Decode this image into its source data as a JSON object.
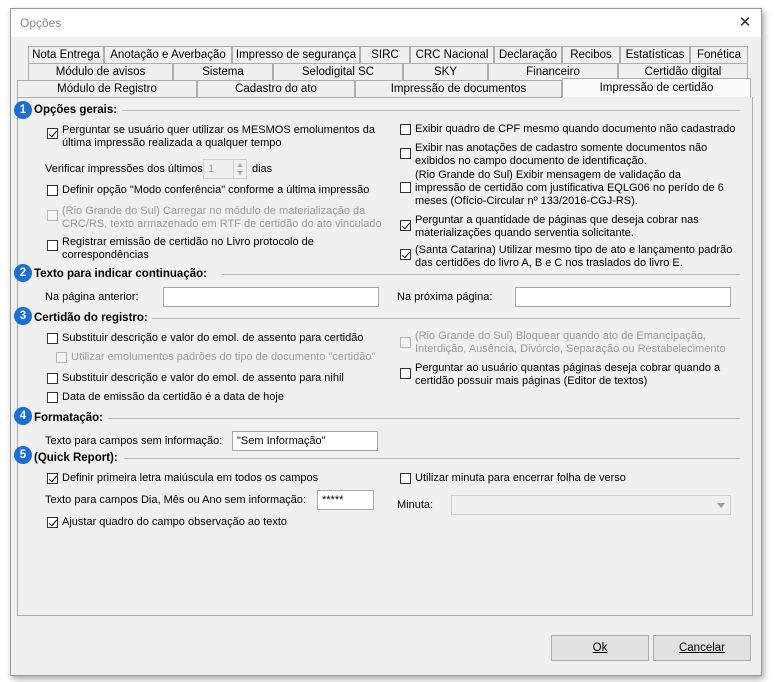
{
  "window": {
    "title": "Opções",
    "close_glyph": "✕"
  },
  "tabs": {
    "row1": [
      "Nota Entrega",
      "Anotação e Averbação",
      "Impresso de segurança",
      "SIRC",
      "CRC Nacional",
      "Declaração",
      "Recibos",
      "Estatísticas",
      "Fonética"
    ],
    "row2": [
      "Módulo de avisos",
      "Sistema",
      "Selodigital SC",
      "SKY",
      "Financeiro",
      "Certidão digital"
    ],
    "row3": [
      "Módulo de Registro",
      "Cadastro do ato",
      "Impressão de documentos",
      "Impressão de certidão"
    ],
    "active": "Impressão de certidão"
  },
  "sections": {
    "s1": {
      "badge": "1",
      "title": "Opções gerais:"
    },
    "s2": {
      "badge": "2",
      "title": "Texto para indicar continuação:"
    },
    "s3": {
      "badge": "3",
      "title": "Certidão do registro:"
    },
    "s4": {
      "badge": "4",
      "title": "Formatação:"
    },
    "s5": {
      "badge": "5",
      "title": "(Quick Report):"
    }
  },
  "general": {
    "ask_same_fees": {
      "label": "Perguntar se usuário quer utilizar os MESMOS emolumentos da última impressão realizada a qualquer tempo",
      "checked": true
    },
    "verify_label": "Verificar impressões dos últimos",
    "verify_value": "1",
    "verify_unit": "dias",
    "conference_mode": {
      "label": "Definir opção \"Modo conferência\" conforme a última impressão",
      "checked": false
    },
    "rgs_load_rtf": {
      "label": "(Rio Grande do Sul) Carregar no módulo de materialização da CRC/RS, texto armazenado em RTF de certidão do ato vinculado",
      "checked": false
    },
    "register_book": {
      "label": "Registrar emissão de certidão no Livro protocolo de correspondências",
      "checked": false
    },
    "show_cpf": {
      "label": "Exibir quadro de CPF mesmo quando documento não cadastrado",
      "checked": false
    },
    "show_annotations": {
      "label": "Exibir nas anotações de cadastro somente documentos não exibidos no campo documento de identificação.",
      "checked": false
    },
    "rgs_validation": {
      "label": "(Rio Grande do Sul) Exibir mensagem de validação da impressão de certidão com justificativa EQLG06 no perído de 6 meses (Ofício-Circular nº 133/2016-CGJ-RS).",
      "checked": false
    },
    "ask_pages": {
      "label": "Perguntar a quantidade de páginas que deseja cobrar nas materializações quando serventia solicitante.",
      "checked": true
    },
    "sc_same_type": {
      "label": "(Santa Catarina) Utilizar mesmo tipo de ato e lançamento padrão das certidões do livro A, B e C nos traslados do livro E.",
      "checked": true
    }
  },
  "continuation": {
    "prev_label": "Na página anterior:",
    "prev_value": "",
    "next_label": "Na próxima página:",
    "next_value": ""
  },
  "registry": {
    "replace_desc": {
      "label": "Substituir descrição e valor do emol. de assento para certidão",
      "checked": false
    },
    "use_default_fees": {
      "label": "Utilizar emolumentos padrões do tipo de documento \"certidão\"",
      "checked": false
    },
    "replace_desc_nihil": {
      "label": "Substituir descrição e valor do emol. de assento para nihil",
      "checked": false
    },
    "issue_date_today": {
      "label": "Data de emissão da certidão é a data de hoje",
      "checked": false
    },
    "rgs_block": {
      "label": "(Rio Grande do Sul) Bloquear quando ato de Emancipação, Interdição, Ausência, Divórcio, Separação ou Restabelecimento",
      "checked": false
    },
    "ask_more_pages": {
      "label": "Perguntar ao usuário quantas páginas deseja cobrar quando a certidão possuir mais páginas (Editor de textos)",
      "checked": false
    }
  },
  "formatting": {
    "empty_label": "Texto para campos sem informação:",
    "empty_value": "\"Sem Informação\""
  },
  "quick_report": {
    "capitalize": {
      "label": "Definir primeira letra maiúscula em todos os campos",
      "checked": true
    },
    "date_label": "Texto para campos Dia, Mês ou Ano sem informação:",
    "date_value": "*****",
    "adjust_obs": {
      "label": "Ajustar quadro do campo observação ao texto",
      "checked": true
    },
    "use_draft": {
      "label": "Utilizar minuta para encerrar folha de verso",
      "checked": false
    },
    "draft_label": "Minuta:",
    "draft_value": ""
  },
  "buttons": {
    "ok": "Ok",
    "cancel": "Cancelar"
  },
  "colors": {
    "badge": "#1a6ed8",
    "window_bg": "#f0f0f0"
  }
}
